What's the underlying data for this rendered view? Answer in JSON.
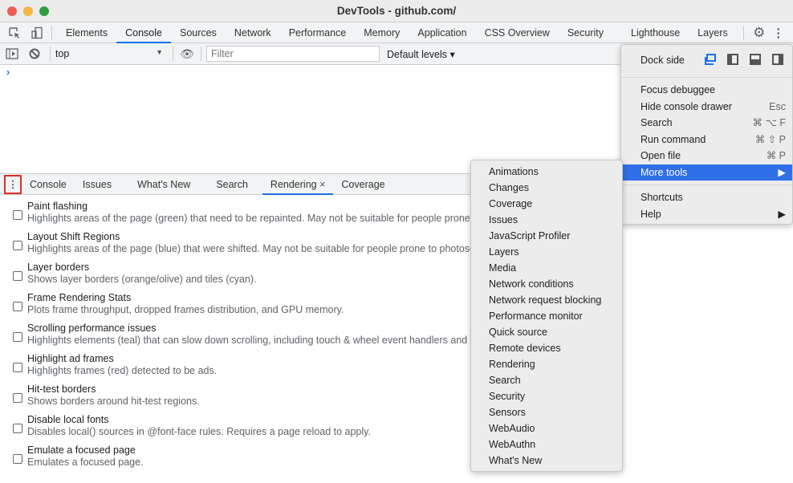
{
  "window": {
    "title": "DevTools - github.com/"
  },
  "main_tabs": [
    "Elements",
    "Console",
    "Sources",
    "Network",
    "Performance",
    "Memory",
    "Application",
    "CSS Overview",
    "Security",
    "Lighthouse",
    "Layers"
  ],
  "console_toolbar": {
    "context": "top",
    "filter_placeholder": "Filter",
    "levels": "Default levels ▾",
    "prompt": "›"
  },
  "drawer_tabs": [
    "Console",
    "Issues",
    "What's New",
    "Search",
    "Rendering",
    "Coverage"
  ],
  "drawer_close": "×",
  "rendering_items": [
    {
      "title": "Paint flashing",
      "desc": "Highlights areas of the page (green) that need to be repainted. May not be suitable for people prone to"
    },
    {
      "title": "Layout Shift Regions",
      "desc": "Highlights areas of the page (blue) that were shifted. May not be suitable for people prone to photosens"
    },
    {
      "title": "Layer borders",
      "desc": "Shows layer borders (orange/olive) and tiles (cyan)."
    },
    {
      "title": "Frame Rendering Stats",
      "desc": "Plots frame throughput, dropped frames distribution, and GPU memory."
    },
    {
      "title": "Scrolling performance issues",
      "desc": "Highlights elements (teal) that can slow down scrolling, including touch & wheel event handlers and oth"
    },
    {
      "title": "Highlight ad frames",
      "desc": "Highlights frames (red) detected to be ads."
    },
    {
      "title": "Hit-test borders",
      "desc": "Shows borders around hit-test regions."
    },
    {
      "title": "Disable local fonts",
      "desc": "Disables local() sources in @font-face rules. Requires a page reload to apply."
    },
    {
      "title": "Emulate a focused page",
      "desc": "Emulates a focused page."
    }
  ],
  "menu": {
    "dock_side": "Dock side",
    "items": [
      {
        "label": "Focus debuggee",
        "shortcut": ""
      },
      {
        "label": "Hide console drawer",
        "shortcut": "Esc"
      },
      {
        "label": "Search",
        "shortcut": "⌘ ⌥ F"
      },
      {
        "label": "Run command",
        "shortcut": "⌘ ⇧ P"
      },
      {
        "label": "Open file",
        "shortcut": "⌘ P"
      },
      {
        "label": "More tools",
        "shortcut": "▶"
      }
    ],
    "items2": [
      {
        "label": "Shortcuts",
        "shortcut": ""
      },
      {
        "label": "Help",
        "shortcut": "▶"
      }
    ]
  },
  "more_tools": [
    "Animations",
    "Changes",
    "Coverage",
    "Issues",
    "JavaScript Profiler",
    "Layers",
    "Media",
    "Network conditions",
    "Network request blocking",
    "Performance monitor",
    "Quick source",
    "Remote devices",
    "Rendering",
    "Search",
    "Security",
    "Sensors",
    "WebAudio",
    "WebAuthn",
    "What's New"
  ],
  "colors": {
    "accent": "#1a73e8",
    "highlight": "#2f6fe8",
    "outline": "#d93025"
  }
}
